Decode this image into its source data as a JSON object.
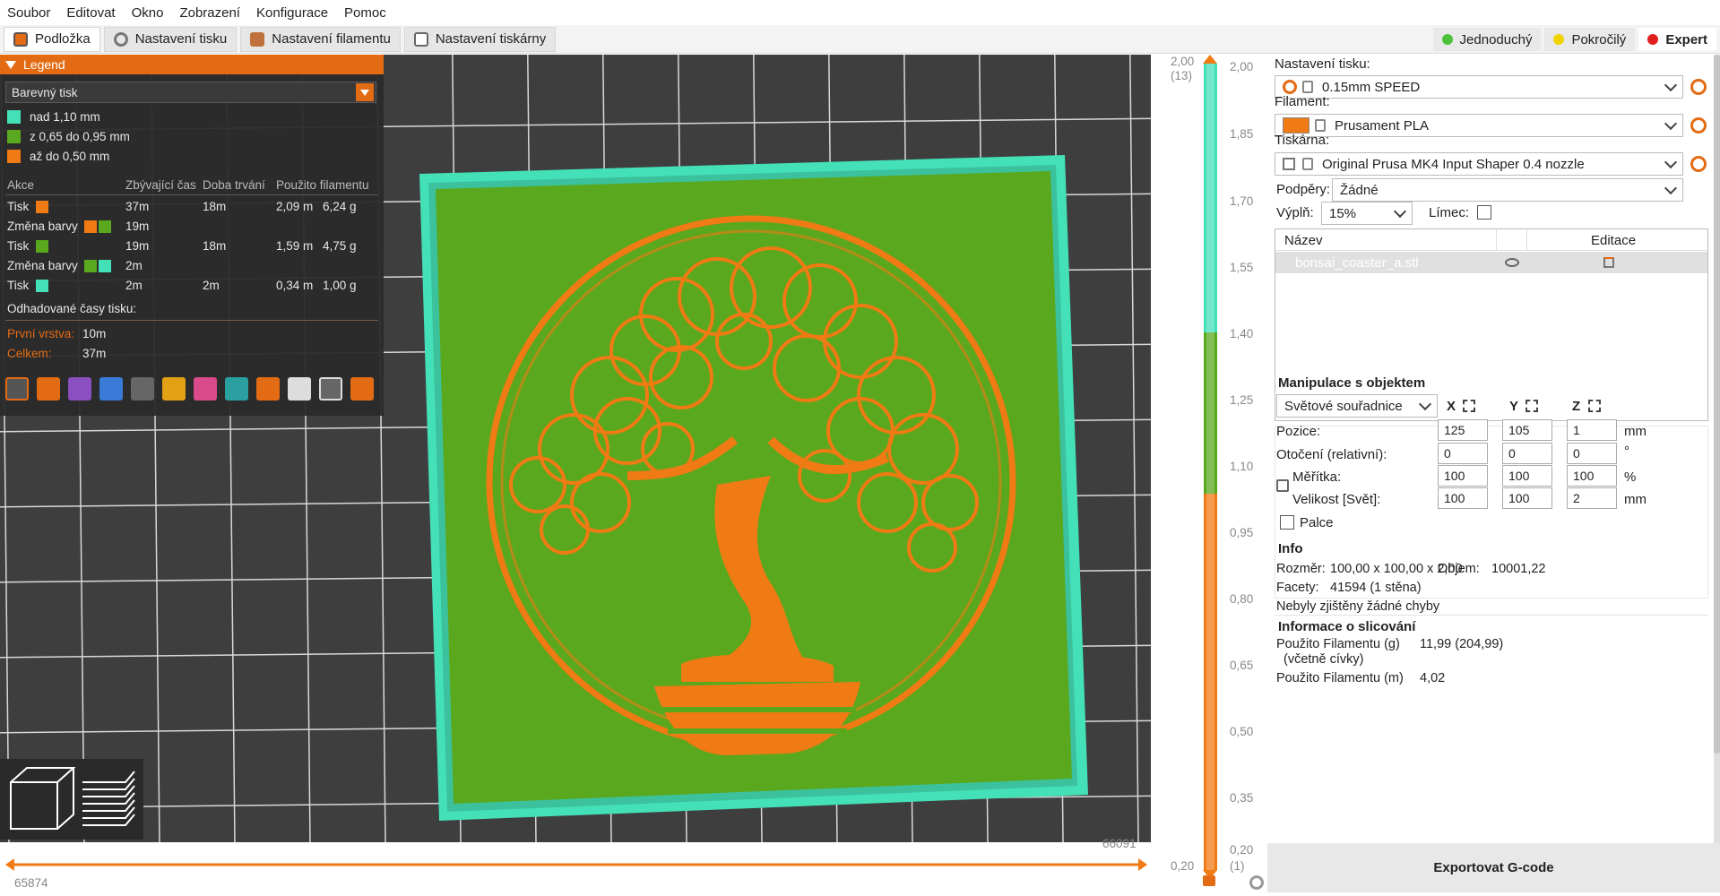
{
  "menu": [
    "Soubor",
    "Editovat",
    "Okno",
    "Zobrazení",
    "Konfigurace",
    "Pomoc"
  ],
  "tabs": [
    {
      "label": "Podložka",
      "icon": "plater-icon"
    },
    {
      "label": "Nastavení tisku",
      "icon": "gear-icon"
    },
    {
      "label": "Nastavení filamentu",
      "icon": "spool-icon"
    },
    {
      "label": "Nastavení tiskárny",
      "icon": "printer-icon"
    }
  ],
  "modes": [
    {
      "label": "Jednoduchý",
      "color": "#4cc23a"
    },
    {
      "label": "Pokročilý",
      "color": "#f0d400"
    },
    {
      "label": "Expert",
      "color": "#e0201e"
    }
  ],
  "legend": {
    "title": "Legend",
    "view_type": "Barevný tisk",
    "ranges": [
      {
        "label": "nad 1,10 mm",
        "color": "#44e0b8"
      },
      {
        "label": "z 0,65 do 0,95 mm",
        "color": "#5aa81e"
      },
      {
        "label": "až do 0,50 mm",
        "color": "#f07a14"
      }
    ],
    "headers": [
      "Akce",
      "Zbývající čas",
      "Doba trvání",
      "Použito filamentu"
    ],
    "rows": [
      {
        "action": "Tisk",
        "colors": [
          "#f07a14"
        ],
        "remaining": "37m",
        "duration": "18m",
        "length": "2,09 m",
        "weight": "6,24 g"
      },
      {
        "action": "Změna barvy",
        "colors": [
          "#f07a14",
          "#5aa81e"
        ],
        "remaining": "19m",
        "duration": "",
        "length": "",
        "weight": ""
      },
      {
        "action": "Tisk",
        "colors": [
          "#5aa81e"
        ],
        "remaining": "19m",
        "duration": "18m",
        "length": "1,59 m",
        "weight": "4,75 g"
      },
      {
        "action": "Změna barvy",
        "colors": [
          "#5aa81e",
          "#44e0b8"
        ],
        "remaining": "2m",
        "duration": "",
        "length": "",
        "weight": ""
      },
      {
        "action": "Tisk",
        "colors": [
          "#44e0b8"
        ],
        "remaining": "2m",
        "duration": "2m",
        "length": "0,34 m",
        "weight": "1,00 g"
      }
    ],
    "estimated_title": "Odhadované časy tisku:",
    "first_layer_label": "První vrstva:",
    "first_layer_value": "10m",
    "total_label": "Celkem:",
    "total_value": "37m"
  },
  "layer_slider": {
    "top_value": "2,00",
    "top_layer": "(13)",
    "bottom_value": "0,20",
    "bottom_layer": "(1)",
    "ticks": [
      "2,00",
      "1,85",
      "1,70",
      "1,55",
      "1,40",
      "1,25",
      "1,10",
      "0,95",
      "0,80",
      "0,65",
      "0,50",
      "0,35",
      "0,20"
    ]
  },
  "horizontal_slider": {
    "right_value": "66091",
    "left_value": "65874"
  },
  "panel": {
    "print_settings_label": "Nastavení tisku:",
    "print_settings_value": "0.15mm SPEED",
    "filament_label": "Filament:",
    "filament_value": "Prusament PLA",
    "filament_color": "#f07a14",
    "printer_label": "Tiskárna:",
    "printer_value": "Original Prusa MK4 Input Shaper 0.4 nozzle",
    "supports_label": "Podpěry:",
    "supports_value": "Žádné",
    "infill_label": "Výplň:",
    "infill_value": "15%",
    "brim_label": "Límec:",
    "objects_header_name": "Název",
    "objects_header_edit": "Editace",
    "object_name": "bonsai_coaster_a.stl",
    "manip_title": "Manipulace s objektem",
    "coords_value": "Světové souřadnice",
    "axis_x": "X",
    "axis_y": "Y",
    "axis_z": "Z",
    "position_label": "Pozice:",
    "position": [
      "125",
      "105",
      "1"
    ],
    "position_unit": "mm",
    "rotation_label": "Otočení (relativní):",
    "rotation": [
      "0",
      "0",
      "0"
    ],
    "rotation_unit": "°",
    "scale_label": "Měřítka:",
    "scale": [
      "100",
      "100",
      "100"
    ],
    "scale_unit": "%",
    "size_label": "Velikost [Svět]:",
    "size": [
      "100",
      "100",
      "2"
    ],
    "size_unit": "mm",
    "inches_label": "Palce",
    "info_title": "Info",
    "size_info_label": "Rozměr:",
    "size_info_value": "100,00 x 100,00 x 2,00",
    "volume_label": "Objem:",
    "volume_value": "10001,22",
    "facets_label": "Facety:",
    "facets_value": "41594 (1 stěna)",
    "errors_text": "Nebyly zjištěny žádné chyby",
    "slice_title": "Informace o slicování",
    "used_g_label": "Použito Filamentu (g)",
    "used_g_sub": "(včetně cívky)",
    "used_g_value": "11,99 (204,99)",
    "used_m_label": "Použito Filamentu (m)",
    "used_m_value": "4,02",
    "export_label": "Exportovat G-code"
  },
  "colors": {
    "accent": "#e36b14",
    "layer_top": "#44e0b8",
    "layer_mid": "#5aa81e",
    "layer_bottom": "#f07a14"
  }
}
